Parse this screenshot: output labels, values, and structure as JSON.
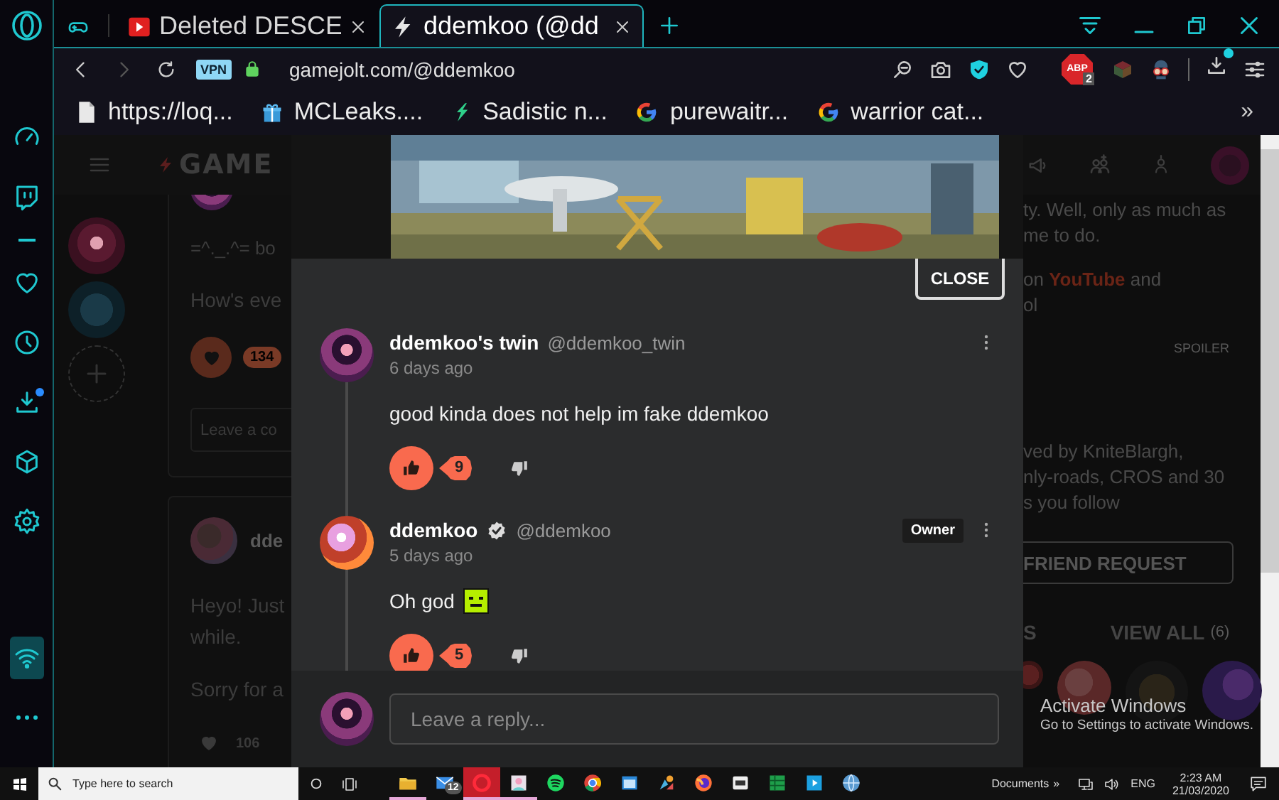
{
  "browser": {
    "tabs": [
      {
        "kind": "pinned",
        "selected": false
      },
      {
        "kind": "video",
        "title": "Deleted DESCE",
        "selected": false
      },
      {
        "kind": "bolt",
        "title": "ddemkoo (@dd",
        "selected": true
      }
    ],
    "toolbar": {
      "vpn": "VPN",
      "url": "gamejolt.com/@ddemkoo",
      "abp": "ABP",
      "abp_count": "2",
      "download_dot": true
    },
    "bookmarks": [
      {
        "kind": "file",
        "title": "https://loq..."
      },
      {
        "kind": "gift",
        "title": "MCLeaks...."
      },
      {
        "kind": "leaf",
        "title": "Sadistic n..."
      },
      {
        "kind": "google",
        "title": "purewaitr..."
      },
      {
        "kind": "google",
        "title": "warrior cat..."
      }
    ],
    "bookmarks_more": "»"
  },
  "sidebar": {
    "items": [
      {
        "kind": "speed-dial",
        "selected": false,
        "badge": false
      },
      {
        "kind": "twitch",
        "selected": false,
        "badge": false
      },
      {
        "kind": "heart",
        "selected": false,
        "badge": false
      },
      {
        "kind": "history",
        "selected": false,
        "badge": false
      },
      {
        "kind": "downloads",
        "selected": false,
        "badge": true
      },
      {
        "kind": "extensions",
        "selected": false,
        "badge": false
      },
      {
        "kind": "settings",
        "selected": false,
        "badge": false
      }
    ],
    "footer_items": [
      {
        "kind": "wifi",
        "selected": true,
        "badge": false
      },
      {
        "kind": "more",
        "selected": false,
        "badge": false
      }
    ]
  },
  "page": {
    "logo": "GAME",
    "left": {
      "post1": {
        "line": "=^._.^= bo",
        "body": "How's eve",
        "likes": "134",
        "placeholder": "Leave a co"
      },
      "post2": {
        "author": "dde",
        "lines": [
          "Heyo! Just",
          "while."
        ],
        "body": "Sorry for a",
        "likes": "106"
      }
    },
    "right": {
      "intro": [
        "ty. Well, only as much as",
        "me to do."
      ],
      "youtube": {
        "before": "on",
        "link": "YouTube",
        "after": "and"
      },
      "tail": "ol",
      "spoiler": "SPOILER",
      "followed": [
        "ved by KniteBlargh,",
        "nly-roads, CROS and 30",
        "s you follow"
      ],
      "friend_button": "FRIEND REQUEST",
      "section_label": "S",
      "view_all": "VIEW ALL",
      "view_all_count": "(6)"
    }
  },
  "modal": {
    "close": "CLOSE",
    "comments": [
      {
        "name": "ddemkoo's twin",
        "verified": false,
        "handle": "@ddemkoo_twin",
        "time": "6 days ago",
        "body": "good kinda does not help im fake ddemkoo",
        "sticker": false,
        "likes": "9",
        "liked": true
      },
      {
        "name": "ddemkoo",
        "verified": true,
        "handle": "@ddemkoo",
        "badge": "Owner",
        "time": "5 days ago",
        "body": "Oh god",
        "sticker": true,
        "likes": "5",
        "liked": true
      }
    ],
    "reply_placeholder": "Leave a reply..."
  },
  "activation": {
    "title": "Activate Windows",
    "hint": "Go to Settings to activate Windows."
  },
  "taskbar": {
    "search_placeholder": "Type here to search",
    "apps": [
      {
        "kind": "explorer",
        "running": true,
        "selected": false
      },
      {
        "kind": "mail",
        "running": false,
        "selected": false,
        "count": "12"
      },
      {
        "kind": "opera",
        "running": true,
        "selected": true
      },
      {
        "kind": "photos",
        "running": true,
        "selected": false
      },
      {
        "kind": "spotify",
        "running": false,
        "selected": false
      },
      {
        "kind": "chrome",
        "running": false,
        "selected": false
      },
      {
        "kind": "window",
        "running": false,
        "selected": false
      },
      {
        "kind": "paint",
        "running": false,
        "selected": false
      },
      {
        "kind": "firefox",
        "running": false,
        "selected": false
      },
      {
        "kind": "box",
        "running": false,
        "selected": false
      },
      {
        "kind": "sheet",
        "running": false,
        "selected": false
      },
      {
        "kind": "media",
        "running": false,
        "selected": false
      },
      {
        "kind": "globe",
        "running": false,
        "selected": false
      }
    ],
    "documents": "Documents",
    "chevron": "»",
    "lang": "ENG",
    "time": "2:23 AM",
    "date": "21/03/2020"
  }
}
